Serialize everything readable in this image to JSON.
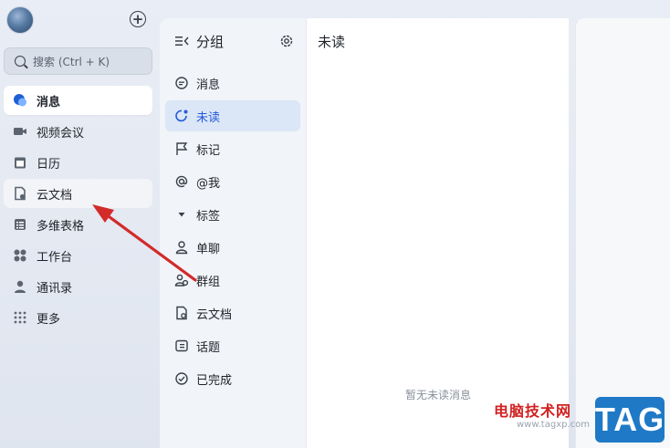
{
  "search": {
    "placeholder": "搜索 (Ctrl + K)"
  },
  "sidebar": {
    "items": [
      {
        "label": "消息",
        "icon": "message-bubble-icon"
      },
      {
        "label": "视频会议",
        "icon": "video-icon"
      },
      {
        "label": "日历",
        "icon": "calendar-icon"
      },
      {
        "label": "云文档",
        "icon": "cloud-doc-icon"
      },
      {
        "label": "多维表格",
        "icon": "table-icon"
      },
      {
        "label": "工作台",
        "icon": "apps-icon"
      },
      {
        "label": "通讯录",
        "icon": "contacts-icon"
      },
      {
        "label": "更多",
        "icon": "more-grid-icon"
      }
    ]
  },
  "groups": {
    "title": "分组",
    "items": [
      {
        "label": "消息",
        "icon": "chat-icon"
      },
      {
        "label": "未读",
        "icon": "unread-icon"
      },
      {
        "label": "标记",
        "icon": "flag-icon"
      },
      {
        "label": "@我",
        "icon": "at-icon"
      },
      {
        "label": "标签",
        "icon": "triangle-down-icon"
      },
      {
        "label": "单聊",
        "icon": "person-icon"
      },
      {
        "label": "群组",
        "icon": "group-icon"
      },
      {
        "label": "云文档",
        "icon": "doc-icon"
      },
      {
        "label": "话题",
        "icon": "topic-icon"
      },
      {
        "label": "已完成",
        "icon": "check-circle-icon"
      }
    ]
  },
  "messages": {
    "title": "未读",
    "empty_text": "暂无未读消息"
  },
  "watermark": {
    "site": "电脑技术网",
    "url": "www.tagxp.com",
    "tag": "TAG"
  },
  "colors": {
    "accent": "#245bdb",
    "active_bg": "#dbe6f7",
    "arrow": "#d32a2a"
  }
}
